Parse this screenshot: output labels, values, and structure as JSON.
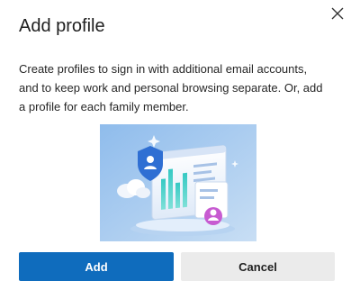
{
  "dialog": {
    "title": "Add profile",
    "description": "Create profiles to sign in with additional email accounts, and to keep work and personal browsing separate. Or, add a profile for each family member.",
    "close_icon": "close-icon",
    "illustration_icon": "profiles-illustration"
  },
  "buttons": {
    "add_label": "Add",
    "cancel_label": "Cancel"
  },
  "colors": {
    "primary": "#0f6cbd",
    "secondary": "#ebebeb",
    "illustration_bg": "#aacdee",
    "text": "#1f1f1f"
  }
}
